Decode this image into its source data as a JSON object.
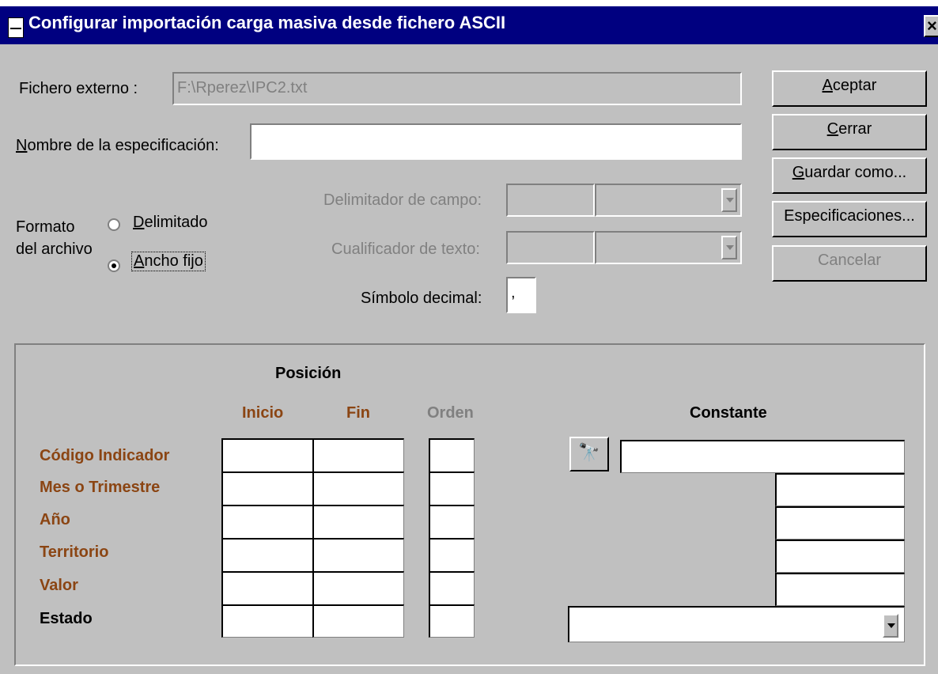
{
  "window": {
    "title": "Configurar importación carga masiva desde fichero ASCII",
    "close_glyph": "×"
  },
  "form": {
    "external_file_label": "Fichero externo :",
    "external_file_value": "F:\\Rperez\\IPC2.txt",
    "spec_name_label_mnemonic": "N",
    "spec_name_label_rest": "ombre de la especificación:",
    "spec_name_value": "",
    "format_label_line1": "Formato",
    "format_label_line2": "del archivo",
    "radio_delimited_mnemonic": "D",
    "radio_delimited_rest": "elimitado",
    "radio_fixed_mnemonic": "A",
    "radio_fixed_rest": "ncho fijo",
    "format_selected": "Ancho fijo",
    "field_delimiter_label": "Delimitador de campo:",
    "text_qualifier_label": "Cualificador de texto:",
    "decimal_symbol_label": "Símbolo decimal:",
    "decimal_symbol_value": ","
  },
  "buttons": {
    "accept_m": "A",
    "accept_r": "ceptar",
    "close_m": "C",
    "close_r": "errar",
    "save_as_m": "G",
    "save_as_r": "uardar como...",
    "specs": "Especificaciones...",
    "cancel": "Cancelar"
  },
  "mapping": {
    "position_header": "Posición",
    "start_header": "Inicio",
    "end_header": "Fin",
    "order_header": "Orden",
    "constant_header": "Constante",
    "rows": [
      {
        "label": "Código Indicador"
      },
      {
        "label": "Mes o Trimestre"
      },
      {
        "label": "Año"
      },
      {
        "label": "Territorio"
      },
      {
        "label": "Valor"
      },
      {
        "label": "Estado"
      }
    ],
    "binoculars_glyph": "🔭",
    "label_color": "#8b4513"
  }
}
